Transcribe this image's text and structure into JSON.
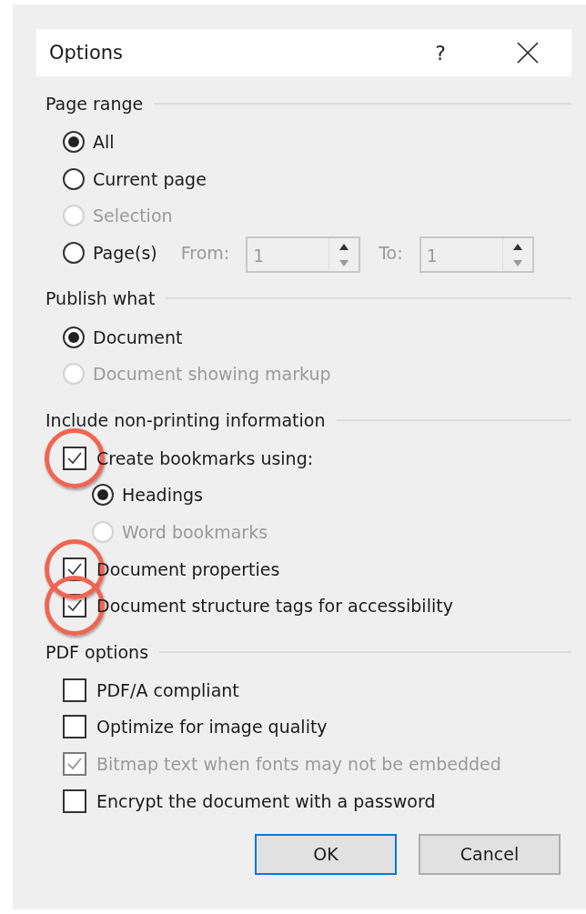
{
  "window": {
    "title": "Options",
    "help": "?"
  },
  "sections": [
    {
      "heading": "Page range",
      "items": [
        {
          "kind": "radio",
          "label": "All",
          "selected": true,
          "disabled": false
        },
        {
          "kind": "radio",
          "label": "Current page",
          "selected": false,
          "disabled": false
        },
        {
          "kind": "radio",
          "label": "Selection",
          "selected": false,
          "disabled": true
        },
        {
          "kind": "radio",
          "label": "Page(s)",
          "selected": false,
          "disabled": false,
          "range": {
            "from_label": "From:",
            "from_value": "1",
            "to_label": "To:",
            "to_value": "1",
            "disabled": true
          }
        }
      ]
    },
    {
      "heading": "Publish what",
      "items": [
        {
          "kind": "radio",
          "label": "Document",
          "selected": true,
          "disabled": false
        },
        {
          "kind": "radio",
          "label": "Document showing markup",
          "selected": false,
          "disabled": true
        }
      ]
    },
    {
      "heading": "Include non-printing information",
      "items": [
        {
          "kind": "checkbox",
          "label": "Create bookmarks using:",
          "checked": true,
          "disabled": false,
          "circled": true,
          "children": [
            {
              "kind": "radio",
              "label": "Headings",
              "selected": true,
              "disabled": false
            },
            {
              "kind": "radio",
              "label": "Word bookmarks",
              "selected": false,
              "disabled": true
            }
          ]
        },
        {
          "kind": "checkbox",
          "label": "Document properties",
          "checked": true,
          "disabled": false,
          "circled": true
        },
        {
          "kind": "checkbox",
          "label": "Document structure tags for accessibility",
          "checked": true,
          "disabled": false,
          "circled": true
        }
      ]
    },
    {
      "heading": "PDF options",
      "items": [
        {
          "kind": "checkbox",
          "label": "PDF/A compliant",
          "checked": false,
          "disabled": false,
          "circled": false
        },
        {
          "kind": "checkbox",
          "label": "Optimize for image quality",
          "checked": false,
          "disabled": false,
          "circled": false
        },
        {
          "kind": "checkbox",
          "label": "Bitmap text when fonts may not be embedded",
          "checked": true,
          "disabled": true,
          "circled": false
        },
        {
          "kind": "checkbox",
          "label": "Encrypt the document with a password",
          "checked": false,
          "disabled": false,
          "circled": false
        }
      ]
    }
  ],
  "buttons": [
    {
      "label": "OK",
      "default": true
    },
    {
      "label": "Cancel",
      "default": false
    }
  ]
}
